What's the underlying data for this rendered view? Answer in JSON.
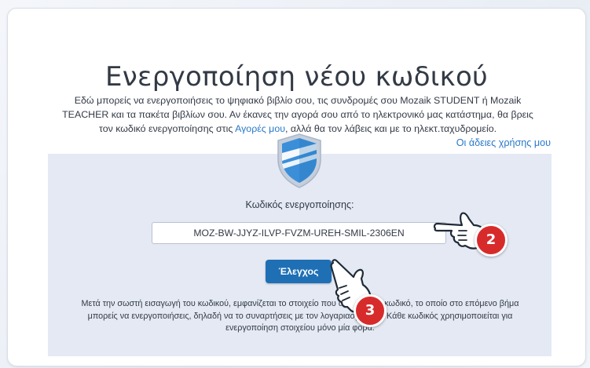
{
  "page": {
    "title": "Ενεργοποίηση νέου κωδικού",
    "description_part1": "Εδώ μπορείς να ενεργοποιήσεις το ψηφιακό βιβλίο σου, τις συνδρομές σου Mozaik STUDENT ή Mozaik TEACHER και τα πακέτα βιβλίων σου. Αν έκανες την αγορά σου από το ηλεκτρονικό μας κατάστημα, θα βρεις τον κωδικό ενεργοποίησης στις ",
    "description_link": "Αγορές μου",
    "description_part2": ", αλλά θα τον λάβεις και με το ηλεκτ.ταχυδρομείο.",
    "licenses_link": "Οι άδειες χρήσης μου"
  },
  "activation": {
    "code_label": "Κωδικός ενεργοποίησης:",
    "code_value": "MOZ-BW-JJYZ-ILVP-FVZM-UREH-SMIL-2306EN",
    "check_button": "Έλεγχος",
    "help_text": "Μετά την σωστή εισαγωγή του κωδικού, εμφανίζεται το στοιχείο που ανήκει στον κωδικό, το οποίο στο επόμενο βήμα μπορείς να ενεργοποιήσεις, δηλαδή να το συναρτήσεις με τον λογαριασμό σου. Κάθε κωδικός χρησιμοποιείται για ενεργοποίηση στοιχείου μόνο μία φορά."
  },
  "annotations": {
    "step_2": "2",
    "step_3": "3"
  },
  "colors": {
    "accent": "#1f6fb5",
    "link": "#2a78c8",
    "panel": "#e4e9f4",
    "badge": "#d72b2b"
  },
  "icons": [
    "shield-icon",
    "pointing-hand-icon"
  ]
}
